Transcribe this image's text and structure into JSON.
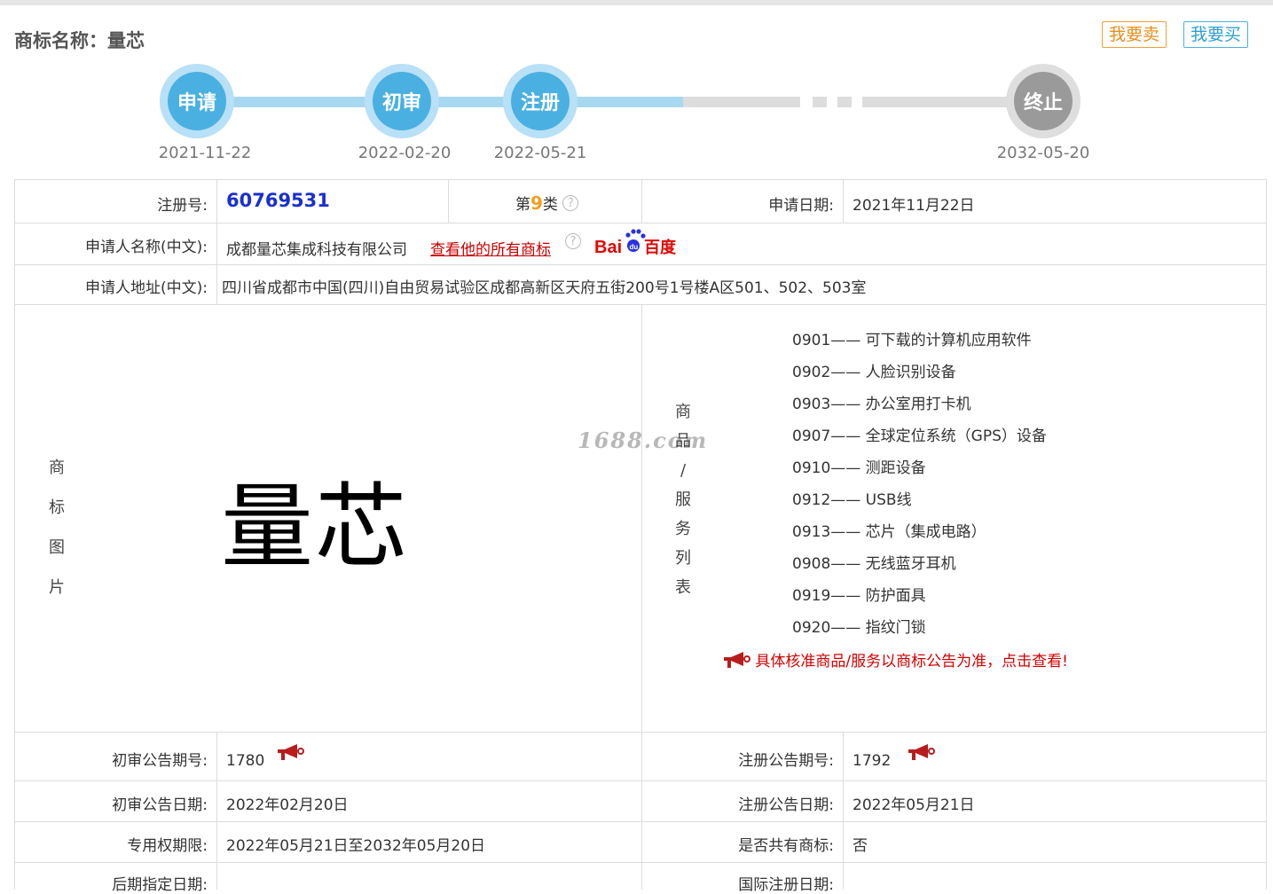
{
  "header": {
    "title": "商标名称：量芯",
    "sell_label": "我要卖",
    "buy_label": "我要买"
  },
  "timeline": {
    "steps": [
      {
        "label": "申请",
        "date": "2021-11-22",
        "state": "done"
      },
      {
        "label": "初审",
        "date": "2022-02-20",
        "state": "done"
      },
      {
        "label": "注册",
        "date": "2022-05-21",
        "state": "done"
      },
      {
        "label": "终止",
        "date": "2032-05-20",
        "state": "future"
      }
    ]
  },
  "details": {
    "reg_no_label": "注册号:",
    "reg_no": "60769531",
    "class_prefix": "第",
    "class_no": "9",
    "class_suffix": "类",
    "help_glyph": "?",
    "apply_date_label": "申请日期:",
    "apply_date": "2021年11月22日",
    "applicant_label": "申请人名称(中文):",
    "applicant": "成都量芯集成科技有限公司",
    "all_marks_link": "查看他的所有商标",
    "baidu_text": "Bai百度",
    "address_label": "申请人地址(中文):",
    "address": "四川省成都市中国(四川)自由贸易试验区成都高新区天府五街200号1号楼A区501、502、503室",
    "mark_image_label": "商标图片",
    "mark_text": "量芯",
    "watermark": "1688.com",
    "goods_label": "商品/服务列表",
    "goods": [
      "0901—— 可下载的计算机应用软件",
      "0902—— 人脸识别设备",
      "0903—— 办公室用打卡机",
      "0907—— 全球定位系统（GPS）设备",
      "0910—— 测距设备",
      "0912—— USB线",
      "0913—— 芯片（集成电路）",
      "0908—— 无线蓝牙耳机",
      "0919—— 防护面具",
      "0920—— 指纹门锁"
    ],
    "goods_notice": "具体核准商品/服务以商标公告为准，点击查看!",
    "prelim_issue_label": "初审公告期号:",
    "prelim_issue": "1780",
    "reg_issue_label": "注册公告期号:",
    "reg_issue": "1792",
    "prelim_date_label": "初审公告日期:",
    "prelim_date": "2022年02月20日",
    "reg_date_label": "注册公告日期:",
    "reg_date": "2022年05月21日",
    "exclusive_label": "专用权期限:",
    "exclusive": "2022年05月21日至2032年05月20日",
    "shared_label": "是否共有商标:",
    "shared": "否",
    "later_label": "后期指定日期:",
    "intl_label": "国际注册日期:"
  },
  "colors": {
    "accent_blue": "#4ab0e2",
    "reg_no": "#1a2fd0",
    "link_red": "#cc0000",
    "class_orange": "#f0a020"
  }
}
